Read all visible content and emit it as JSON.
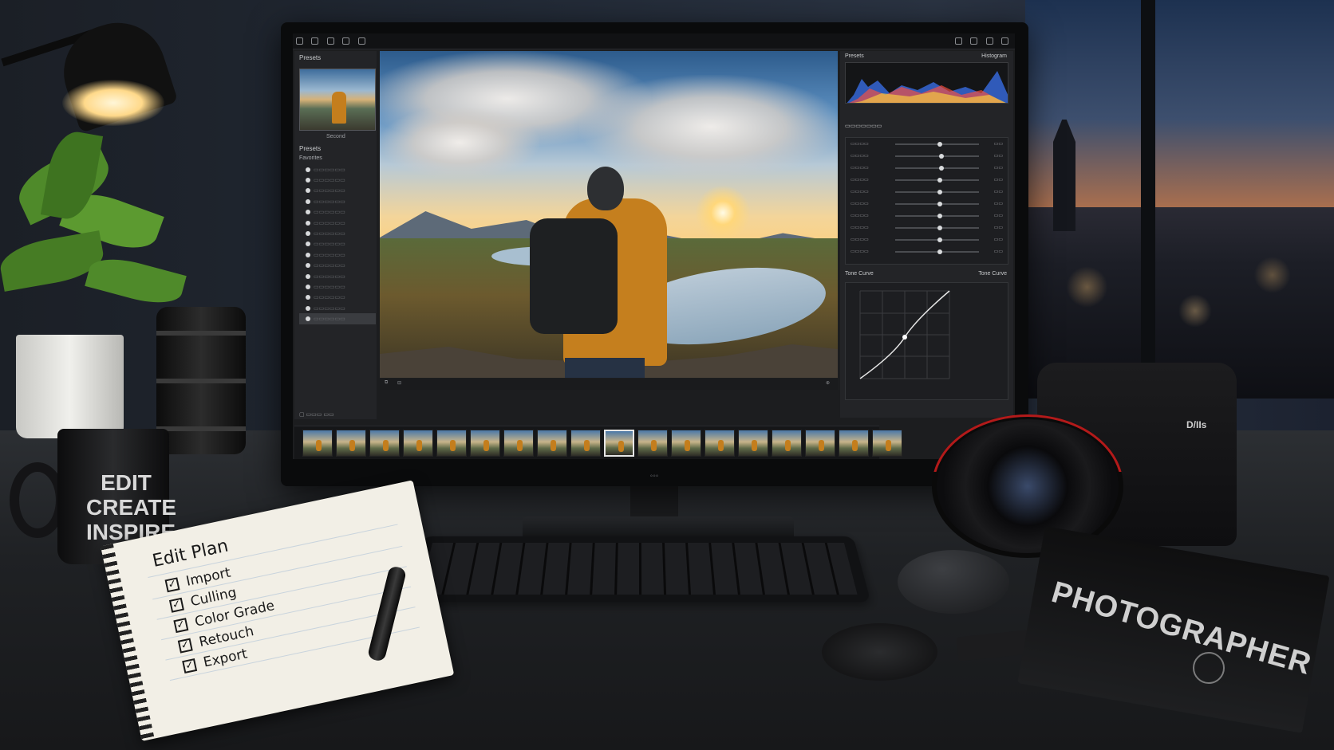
{
  "scene": {
    "mug_text": [
      "EDIT",
      "CREATE",
      "INSPIRE"
    ],
    "notebook": {
      "title": "Edit Plan",
      "items": [
        {
          "label": "Import",
          "checked": true
        },
        {
          "label": "Culling",
          "checked": true
        },
        {
          "label": "Color Grade",
          "checked": true
        },
        {
          "label": "Retouch",
          "checked": true
        },
        {
          "label": "Export",
          "checked": true
        }
      ]
    },
    "book_title": "PHOTOGRAPHER",
    "camera_logo": "D/IIs"
  },
  "app": {
    "left_panel": {
      "title": "Presets",
      "thumbnail_caption": "Second",
      "section_title": "Presets",
      "folder_label": "Favorites",
      "tree_items": 15
    },
    "right_panel": {
      "histogram_left": "Presets",
      "histogram_right": "Histogram",
      "tone_curve_left": "Tone Curve",
      "tone_curve_right": "Tone Curve"
    },
    "filmstrip": {
      "count": 18,
      "selected_index": 9
    },
    "colors": {
      "accent": "#c57f1e",
      "panel": "#232427",
      "screen_bg": "#1c1d1f"
    }
  }
}
